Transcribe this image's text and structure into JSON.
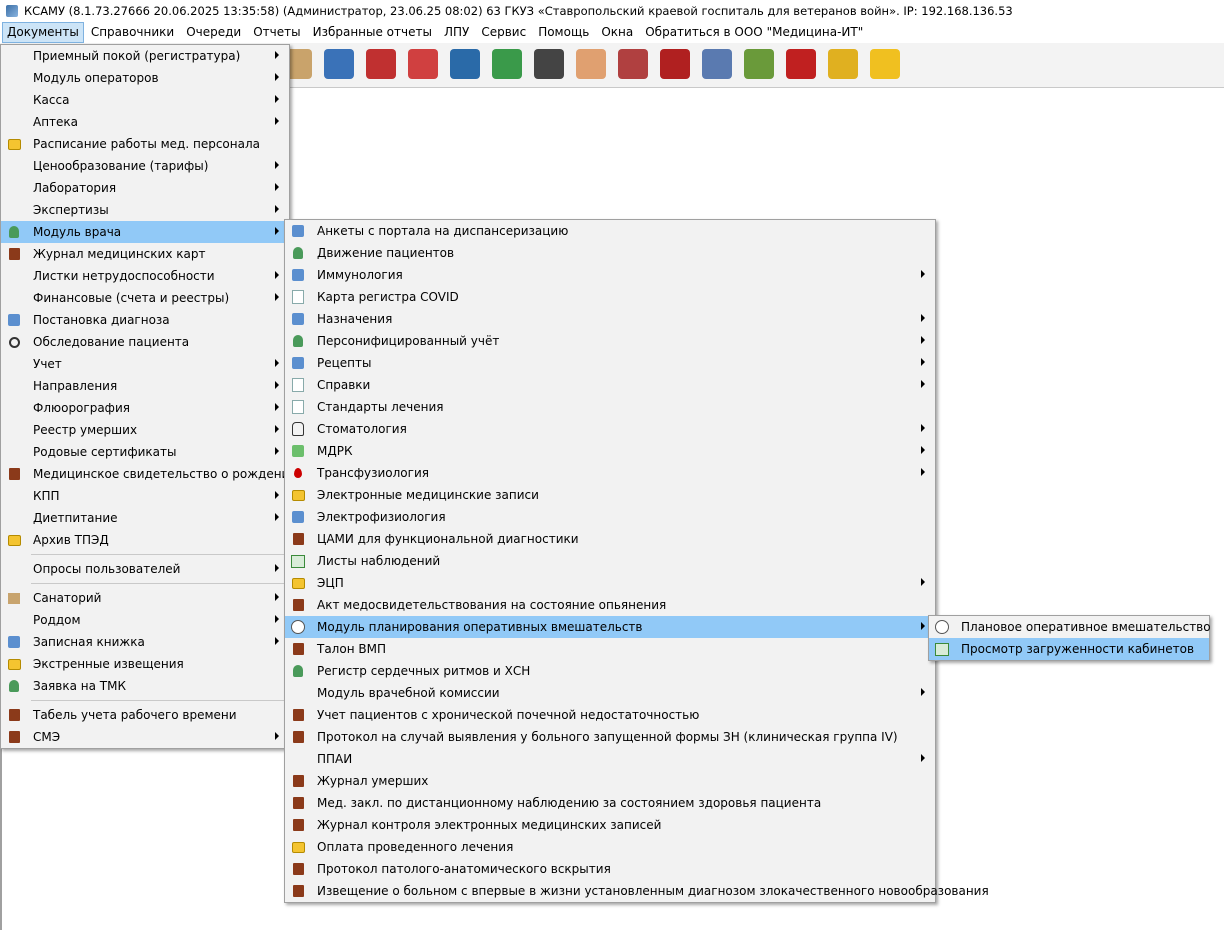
{
  "title": "КСАМУ (8.1.73.27666 20.06.2025 13:35:58) (Администратор, 23.06.25 08:02)  63 ГКУЗ «Ставропольский краевой госпиталь для ветеранов войн». IP: 192.168.136.53",
  "menubar": [
    {
      "label": "Документы"
    },
    {
      "label": "Справочники"
    },
    {
      "label": "Очереди"
    },
    {
      "label": "Отчеты"
    },
    {
      "label": "Избранные отчеты"
    },
    {
      "label": "ЛПУ"
    },
    {
      "label": "Сервис"
    },
    {
      "label": "Помощь"
    },
    {
      "label": "Окна"
    },
    {
      "label": "Обратиться в ООО \"Медицина-ИТ\""
    }
  ],
  "toolbar_icons": [
    "clipboard-icon",
    "calendar-clock-icon",
    "pills-icon",
    "medical-card-icon",
    "syringe-book-icon",
    "capsule-icon",
    "barcode-scanner-icon",
    "nurse-icon",
    "thermometer-icon",
    "red-book-icon",
    "schedule-icon",
    "lock-document-icon",
    "pdf-icon",
    "padlock-icon",
    "speech-bubble-icon"
  ],
  "menu1": [
    {
      "label": "Приемный покой (регистратура)",
      "icon": "none",
      "sub": true
    },
    {
      "label": "Модуль операторов",
      "icon": "none",
      "sub": true
    },
    {
      "label": "Касса",
      "icon": "none",
      "sub": true
    },
    {
      "label": "Аптека",
      "icon": "none",
      "sub": true
    },
    {
      "label": "Расписание работы мед. персонала",
      "icon": "note",
      "sub": false
    },
    {
      "label": "Ценообразование (тарифы)",
      "icon": "none",
      "sub": true
    },
    {
      "label": "Лаборатория",
      "icon": "none",
      "sub": true
    },
    {
      "label": "Экспертизы",
      "icon": "none",
      "sub": true
    },
    {
      "label": "Модуль врача",
      "icon": "person",
      "sub": true,
      "selected": true
    },
    {
      "label": "Журнал медицинских карт",
      "icon": "book",
      "sub": false
    },
    {
      "label": "Листки нетрудоспособности",
      "icon": "none",
      "sub": true
    },
    {
      "label": "Финансовые (счета и реестры)",
      "icon": "none",
      "sub": true
    },
    {
      "label": "Постановка диагноза",
      "icon": "gen",
      "sub": false
    },
    {
      "label": "Обследование пациента",
      "icon": "search",
      "sub": false
    },
    {
      "label": "Учет",
      "icon": "none",
      "sub": true
    },
    {
      "label": "Направления",
      "icon": "none",
      "sub": true
    },
    {
      "label": "Флюорография",
      "icon": "none",
      "sub": true
    },
    {
      "label": "Реестр умерших",
      "icon": "none",
      "sub": true
    },
    {
      "label": "Родовые сертификаты",
      "icon": "none",
      "sub": true
    },
    {
      "label": "Медицинское свидетельство о рождении",
      "icon": "book",
      "sub": false
    },
    {
      "label": "КПП",
      "icon": "none",
      "sub": true
    },
    {
      "label": "Диетпитание",
      "icon": "none",
      "sub": true
    },
    {
      "label": "Архив ТПЭД",
      "icon": "note",
      "sub": false,
      "sep_after": true
    },
    {
      "label": "Опросы пользователей",
      "icon": "none",
      "sub": true,
      "sep_after": true
    },
    {
      "label": "Санаторий",
      "icon": "house",
      "sub": true
    },
    {
      "label": "Роддом",
      "icon": "none",
      "sub": true
    },
    {
      "label": "Записная книжка",
      "icon": "gen",
      "sub": true
    },
    {
      "label": "Экстренные извещения",
      "icon": "note",
      "sub": false
    },
    {
      "label": "Заявка на ТМК",
      "icon": "person",
      "sub": false,
      "sep_after": true
    },
    {
      "label": "Табель учета рабочего времени",
      "icon": "book",
      "sub": false
    },
    {
      "label": "СМЭ",
      "icon": "book",
      "sub": true
    }
  ],
  "menu2": [
    {
      "label": "Анкеты с портала на диспансеризацию",
      "icon": "gen",
      "sub": false
    },
    {
      "label": "Движение пациентов",
      "icon": "person",
      "sub": false
    },
    {
      "label": "Иммунология",
      "icon": "gen",
      "sub": true
    },
    {
      "label": "Карта регистра COVID",
      "icon": "doc",
      "sub": false
    },
    {
      "label": "Назначения",
      "icon": "gen",
      "sub": true
    },
    {
      "label": "Персонифицированный учёт",
      "icon": "person",
      "sub": true
    },
    {
      "label": "Рецепты",
      "icon": "gen",
      "sub": true
    },
    {
      "label": "Справки",
      "icon": "doc",
      "sub": true
    },
    {
      "label": "Стандарты лечения",
      "icon": "doc",
      "sub": false
    },
    {
      "label": "Стоматология",
      "icon": "tooth",
      "sub": true
    },
    {
      "label": "МДРК",
      "icon": "green",
      "sub": true
    },
    {
      "label": "Трансфузиология",
      "icon": "drop",
      "sub": true
    },
    {
      "label": "Электронные медицинские записи",
      "icon": "note",
      "sub": false
    },
    {
      "label": "Электрофизиология",
      "icon": "gen",
      "sub": false
    },
    {
      "label": "ЦАМИ для функциональной диагностики",
      "icon": "book",
      "sub": false
    },
    {
      "label": "Листы наблюдений",
      "icon": "grid",
      "sub": false
    },
    {
      "label": "ЭЦП",
      "icon": "note",
      "sub": true
    },
    {
      "label": "Акт медосвидетельствования на состояние опьянения",
      "icon": "book",
      "sub": false
    },
    {
      "label": "Модуль планирования оперативных вмешательств",
      "icon": "clock",
      "sub": true,
      "selected": true
    },
    {
      "label": "Талон ВМП",
      "icon": "book",
      "sub": false
    },
    {
      "label": "Регистр сердечных ритмов и ХСН",
      "icon": "person",
      "sub": false
    },
    {
      "label": "Модуль врачебной комиссии",
      "icon": "none",
      "sub": true
    },
    {
      "label": "Учет пациентов с хронической почечной недостаточностью",
      "icon": "book",
      "sub": false
    },
    {
      "label": "Протокол на случай выявления у больного запущенной формы ЗН (клиническая группа IV)",
      "icon": "book",
      "sub": false
    },
    {
      "label": "ППАИ",
      "icon": "none",
      "sub": true
    },
    {
      "label": "Журнал умерших",
      "icon": "book",
      "sub": false
    },
    {
      "label": "Мед. закл. по дистанционному наблюдению за состоянием здоровья пациента",
      "icon": "book",
      "sub": false
    },
    {
      "label": "Журнал контроля электронных медицинских записей",
      "icon": "book",
      "sub": false
    },
    {
      "label": "Оплата проведенного лечения",
      "icon": "note",
      "sub": false
    },
    {
      "label": "Протокол патолого-анатомического вскрытия",
      "icon": "book",
      "sub": false
    },
    {
      "label": "Извещение о больном с впервые в жизни установленным диагнозом злокачественного новообразования",
      "icon": "book",
      "sub": false
    }
  ],
  "menu3": [
    {
      "label": "Плановое оперативное вмешательство",
      "icon": "clock",
      "sub": false
    },
    {
      "label": "Просмотр загруженности кабинетов",
      "icon": "grid",
      "sub": false,
      "selected": true
    }
  ]
}
